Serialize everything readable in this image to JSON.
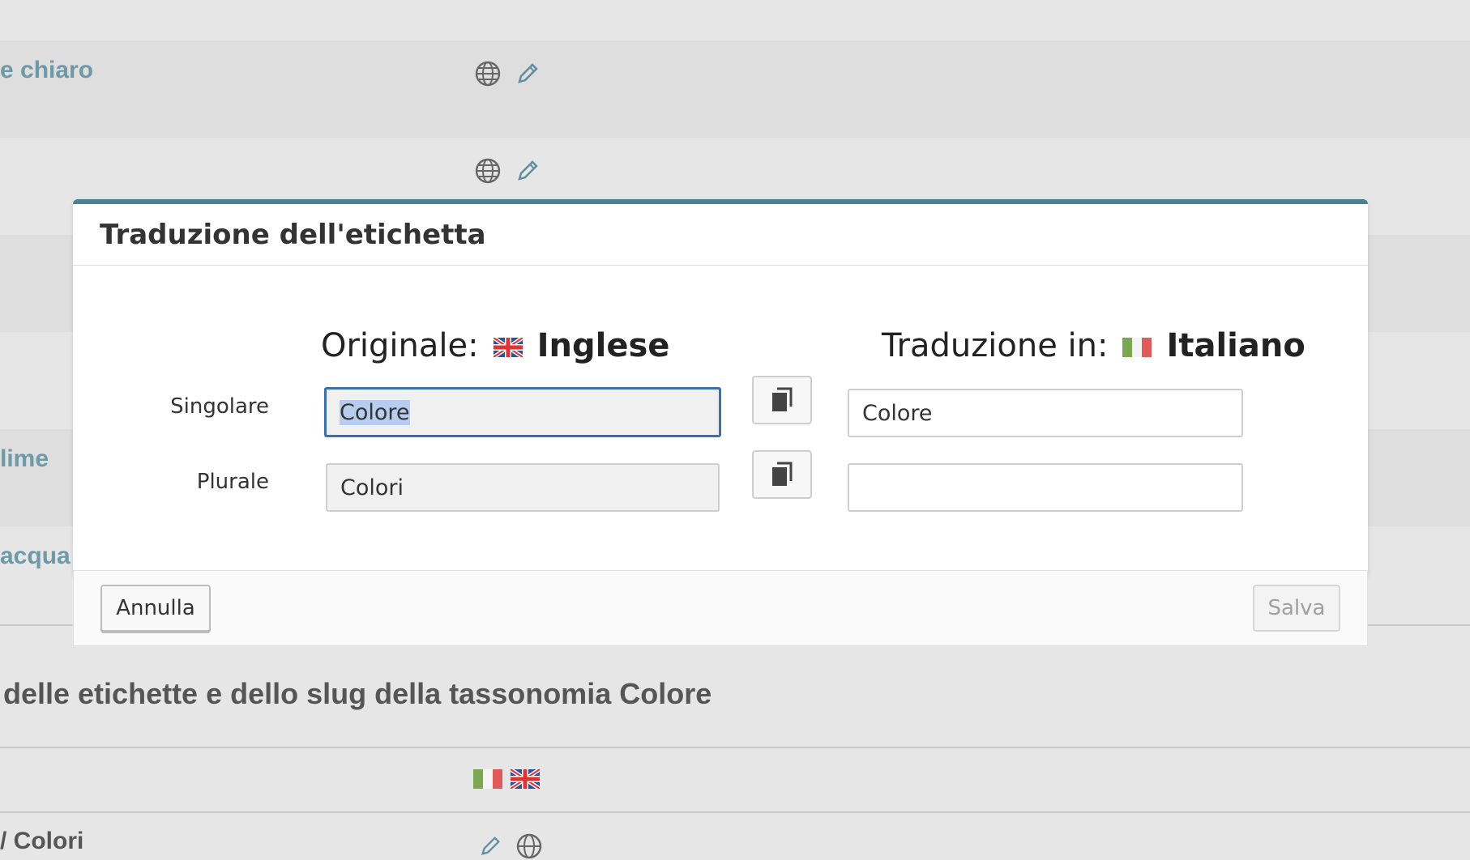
{
  "background": {
    "rows": [
      {
        "link": "e chiaro"
      },
      {
        "link": ""
      },
      {
        "link": "lime"
      },
      {
        "link": "acqua"
      }
    ],
    "section_heading": "delle etichette e dello slug della tassonomia Colore",
    "bottom_row_text": "/ Colori",
    "icons": [
      "globe-icon",
      "pencil-icon",
      "italian-flag-icon",
      "uk-flag-icon"
    ]
  },
  "modal": {
    "title": "Traduzione dell'etichetta",
    "original": {
      "prefix": "Originale:",
      "language": "Inglese"
    },
    "translation": {
      "prefix": "Traduzione in:",
      "language": "Italiano"
    },
    "rows": [
      {
        "label": "Singolare",
        "original_value": "Colore",
        "translation_value": "Colore"
      },
      {
        "label": "Plurale",
        "original_value": "Colori",
        "translation_value": ""
      }
    ],
    "cancel_label": "Annulla",
    "save_label": "Salva"
  },
  "colors": {
    "accent": "#4a8197",
    "link": "#6e9aa8",
    "focus": "#3a70b3"
  }
}
